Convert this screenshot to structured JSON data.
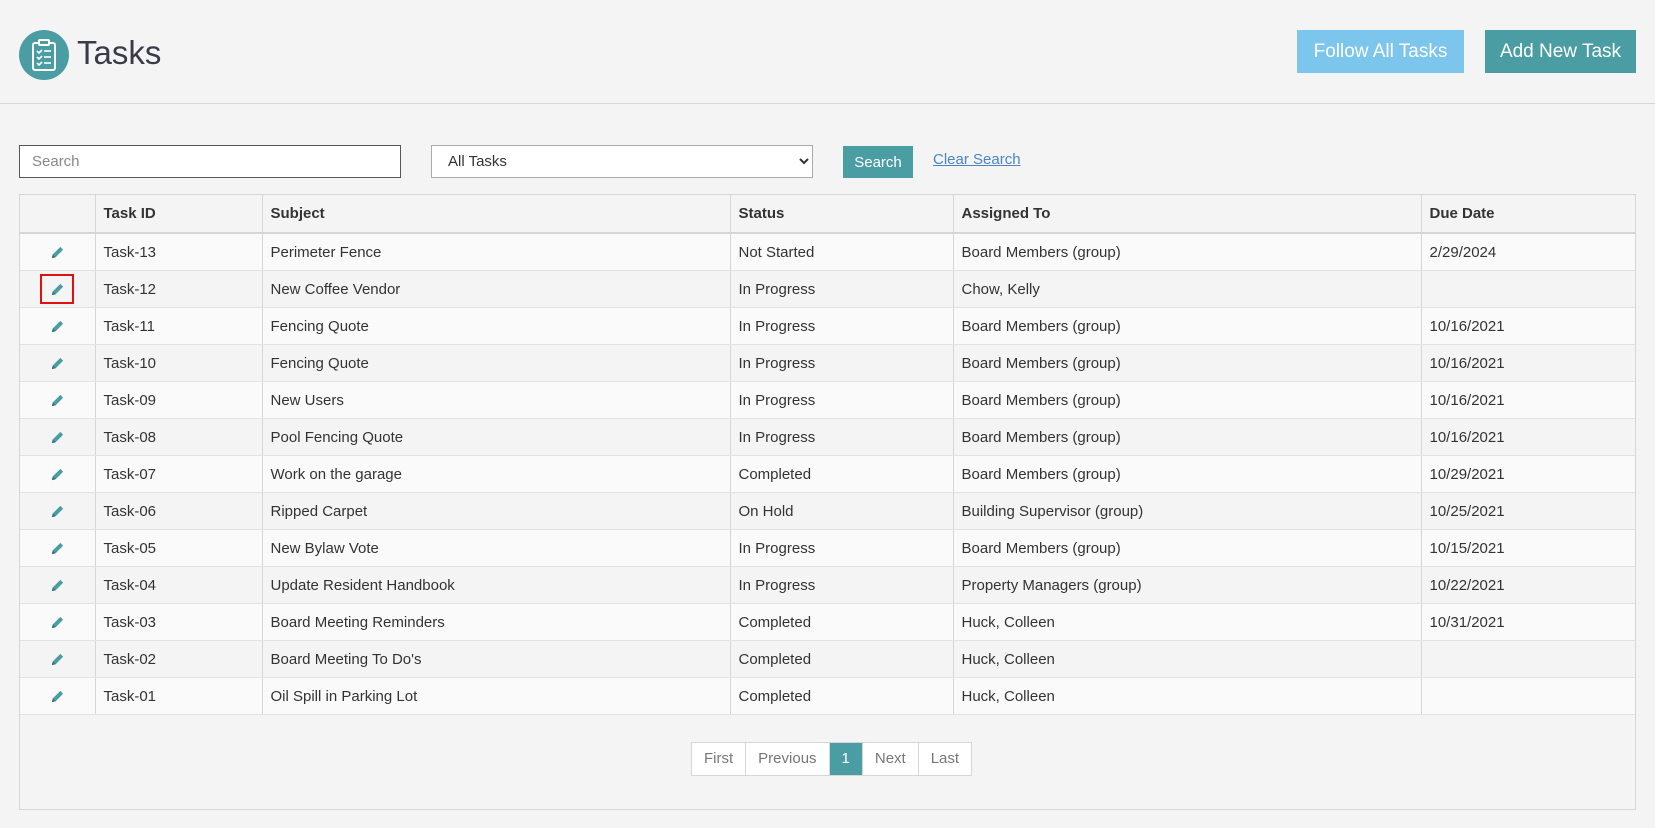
{
  "header": {
    "title": "Tasks",
    "logo_icon": "clipboard-checklist-icon",
    "follow_all_label": "Follow All Tasks",
    "add_new_label": "Add New Task",
    "colors": {
      "accent": "#4a9da3",
      "follow": "#7cc5ec"
    }
  },
  "filters": {
    "search_placeholder": "Search",
    "search_value": "",
    "select_value": "All Tasks",
    "search_button": "Search",
    "clear_link": "Clear Search"
  },
  "table": {
    "columns": [
      "",
      "Task ID",
      "Subject",
      "Status",
      "Assigned To",
      "Due Date"
    ],
    "edit_icon": "pencil-icon",
    "rows": [
      {
        "id": "Task-13",
        "subject": "Perimeter Fence",
        "status": "Not Started",
        "assigned": "Board Members (group)",
        "due": "2/29/2024"
      },
      {
        "id": "Task-12",
        "subject": "New Coffee Vendor",
        "status": "In Progress",
        "assigned": "Chow, Kelly",
        "due": ""
      },
      {
        "id": "Task-11",
        "subject": "Fencing Quote",
        "status": "In Progress",
        "assigned": "Board Members (group)",
        "due": "10/16/2021"
      },
      {
        "id": "Task-10",
        "subject": "Fencing Quote",
        "status": "In Progress",
        "assigned": "Board Members (group)",
        "due": "10/16/2021"
      },
      {
        "id": "Task-09",
        "subject": "New Users",
        "status": "In Progress",
        "assigned": "Board Members (group)",
        "due": "10/16/2021"
      },
      {
        "id": "Task-08",
        "subject": "Pool Fencing Quote",
        "status": "In Progress",
        "assigned": "Board Members (group)",
        "due": "10/16/2021"
      },
      {
        "id": "Task-07",
        "subject": "Work on the garage",
        "status": "Completed",
        "assigned": "Board Members (group)",
        "due": "10/29/2021"
      },
      {
        "id": "Task-06",
        "subject": "Ripped Carpet",
        "status": "On Hold",
        "assigned": "Building Supervisor (group)",
        "due": "10/25/2021"
      },
      {
        "id": "Task-05",
        "subject": "New Bylaw Vote",
        "status": "In Progress",
        "assigned": "Board Members (group)",
        "due": "10/15/2021"
      },
      {
        "id": "Task-04",
        "subject": "Update Resident Handbook",
        "status": "In Progress",
        "assigned": "Property Managers (group)",
        "due": "10/22/2021"
      },
      {
        "id": "Task-03",
        "subject": "Board Meeting Reminders",
        "status": "Completed",
        "assigned": "Huck, Colleen",
        "due": "10/31/2021"
      },
      {
        "id": "Task-02",
        "subject": "Board Meeting To Do's",
        "status": "Completed",
        "assigned": "Huck, Colleen",
        "due": ""
      },
      {
        "id": "Task-01",
        "subject": "Oil Spill in Parking Lot",
        "status": "Completed",
        "assigned": "Huck, Colleen",
        "due": ""
      }
    ]
  },
  "pagination": {
    "first": "First",
    "previous": "Previous",
    "current": "1",
    "next": "Next",
    "last": "Last"
  }
}
